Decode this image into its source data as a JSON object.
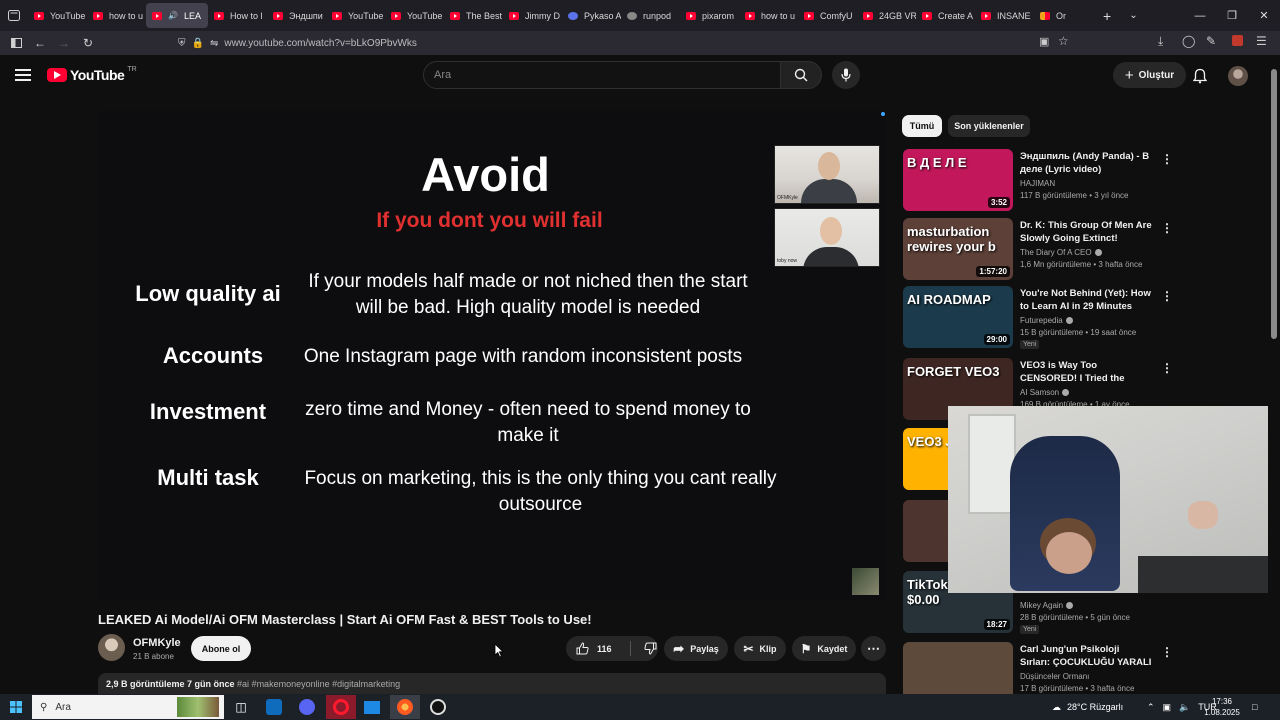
{
  "browser": {
    "tabs": [
      {
        "title": "YouTube",
        "fav": "yt"
      },
      {
        "title": "how to u",
        "fav": "yt"
      },
      {
        "title": "LEA",
        "fav": "yt",
        "active": true
      },
      {
        "title": "How to l",
        "fav": "yt"
      },
      {
        "title": "Эндшпи",
        "fav": "yt"
      },
      {
        "title": "YouTube",
        "fav": "yt"
      },
      {
        "title": "YouTube",
        "fav": "yt"
      },
      {
        "title": "The Best",
        "fav": "yt"
      },
      {
        "title": "Jimmy D",
        "fav": "yt"
      },
      {
        "title": "Pykaso A",
        "fav": "blue"
      },
      {
        "title": "runpod",
        "fav": "gray"
      },
      {
        "title": "pixarom",
        "fav": "yt"
      },
      {
        "title": "how to u",
        "fav": "yt"
      },
      {
        "title": "ComfyU",
        "fav": "yt"
      },
      {
        "title": "24GB VR",
        "fav": "yt"
      },
      {
        "title": "Create A",
        "fav": "yt"
      },
      {
        "title": "INSANE",
        "fav": "yt"
      },
      {
        "title": "Or",
        "fav": "multi"
      }
    ],
    "url": "www.youtube.com/watch?v=bLkO9PbvWks",
    "new_tab_label": "+",
    "tab_list_icon": "tab-list-icon"
  },
  "youtube": {
    "logo_text": "YouTube",
    "region": "TR",
    "search_placeholder": "Ara",
    "create_label": "Oluştur"
  },
  "slide": {
    "title": "Avoid",
    "subtitle": "If you dont you will fail",
    "rows": [
      {
        "label": "Low quality ai",
        "desc": "If your models half made or not niched then the start will be bad. High quality model is needed"
      },
      {
        "label": "Accounts",
        "desc": "One Instagram page with random inconsistent posts"
      },
      {
        "label": "Investment",
        "desc": "zero time and Money - often need to spend money to make it"
      },
      {
        "label": "Multi task",
        "desc": "Focus on marketing, this is the only thing you cant really outsource"
      }
    ],
    "cam1_label": "OFMKyle",
    "cam2_label": "toby now"
  },
  "video": {
    "title": "LEAKED Ai Model/Ai OFM Masterclass | Start Ai OFM Fast & BEST Tools to Use!",
    "channel": "OFMKyle",
    "subscribers": "21 B abone",
    "subscribe_label": "Abone ol",
    "likes": "116",
    "share_label": "Paylaş",
    "clip_label": "Klip",
    "save_label": "Kaydet",
    "views_date": "2,9 B görüntüleme  7 gün önce",
    "tags": "#ai #makemoneyonline #digitalmarketing"
  },
  "chips": [
    "Tümü",
    "Son yüklenenler"
  ],
  "recommendations": [
    {
      "title": "Эндшпиль (Andy Panda) - В деле (Lyric video)",
      "channel": "HAJIMAN",
      "meta": "117 B görüntüleme • 3 yıl önce",
      "duration": "3:52",
      "thumb_text": "B Д Е Л Е",
      "thumb_color": "#c2185b"
    },
    {
      "title": "Dr. K: This Group Of Men Are Slowly Going Extinct!",
      "channel": "The Diary Of A CEO",
      "meta": "1,6 Mn görüntüleme • 3 hafta önce",
      "duration": "1:57:20",
      "thumb_text": "masturbation rewires your b",
      "thumb_color": "#5d4037",
      "verified": true
    },
    {
      "title": "You're Not Behind (Yet): How to Learn AI in 29 Minutes",
      "channel": "Futurepedia",
      "meta": "15 B görüntüleme • 19 saat önce",
      "duration": "29:00",
      "thumb_text": "AI ROADMAP",
      "thumb_color": "#1b3a4b",
      "verified": true,
      "new": "Yeni"
    },
    {
      "title": "VEO3 is Way Too CENSORED! I Tried the BETTER, CHEAPER ...",
      "channel": "AI Samson",
      "meta": "169 B görüntüleme • 1 ay önce",
      "duration": "",
      "thumb_text": "FORGET VEO3",
      "thumb_color": "#3e2723",
      "verified": true
    },
    {
      "title": "",
      "channel": "",
      "meta": "",
      "duration": "",
      "thumb_text": "VEO3 JS PROMI",
      "thumb_color": "#ffb300"
    },
    {
      "title": "",
      "channel": "",
      "meta": "",
      "duration": "",
      "thumb_text": "",
      "thumb_color": "#4e342e"
    },
    {
      "title": "",
      "channel": "Mikey Again",
      "meta": "28 B görüntüleme • 5 gün önce",
      "duration": "18:27",
      "thumb_text": "TikTok Shop $0.00",
      "thumb_color": "#263238",
      "verified": true,
      "new": "Yeni"
    },
    {
      "title": "Carl Jung'un Psikoloji Sırları: ÇOCUKLUĞU YARALI ADAMLAR",
      "channel": "Düşünceler Ormanı",
      "meta": "17 B görüntüleme • 3 hafta önce",
      "duration": "",
      "thumb_text": "",
      "thumb_color": "#5d4a3a"
    }
  ],
  "taskbar": {
    "search_placeholder": "Ara",
    "weather": "28°C  Rüzgarlı",
    "lang": "TUR",
    "time": "17:36",
    "date": "1.08.2025"
  }
}
